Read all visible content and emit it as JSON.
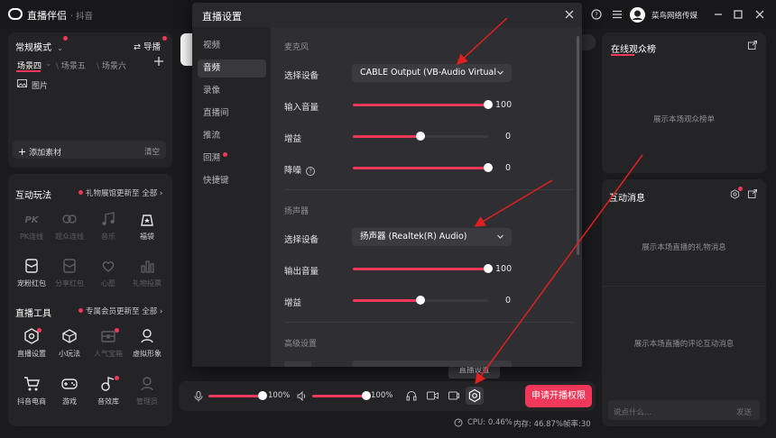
{
  "app": {
    "title": "直播伴侣",
    "subtitle": "· 抖音",
    "user": "菜鸟网络传媒"
  },
  "scene_panel": {
    "mode": "常规模式",
    "guide": "导播",
    "tabs": [
      "场景四",
      "场景五",
      "场景六"
    ],
    "item": "图片",
    "add_source": "添加素材",
    "clear": "清空"
  },
  "interact_panel": {
    "title": "互动玩法",
    "note": "礼物展馆更新至 全部",
    "items": [
      {
        "label": "PK连线",
        "icon": "pk-icon",
        "enabled": false
      },
      {
        "label": "观众连线",
        "icon": "link-icon",
        "enabled": false
      },
      {
        "label": "音乐",
        "icon": "music-icon",
        "enabled": false
      },
      {
        "label": "福袋",
        "icon": "lucky-bag-icon",
        "enabled": true
      },
      {
        "label": "宠粉红包",
        "icon": "red-packet-icon",
        "enabled": true
      },
      {
        "label": "分享红包",
        "icon": "share-packet-icon",
        "enabled": false
      },
      {
        "label": "心愿",
        "icon": "wish-icon",
        "enabled": false
      },
      {
        "label": "礼物投票",
        "icon": "vote-icon",
        "enabled": false
      }
    ]
  },
  "tools_panel": {
    "title": "直播工具",
    "note": "专属会员更新至 全部",
    "items": [
      {
        "label": "直播设置",
        "icon": "live-settings-icon",
        "enabled": true
      },
      {
        "label": "小玩法",
        "icon": "mini-game-icon",
        "enabled": true
      },
      {
        "label": "人气宝箱",
        "icon": "treasure-box-icon",
        "enabled": false
      },
      {
        "label": "虚拟形象",
        "icon": "avatar-icon",
        "enabled": true
      },
      {
        "label": "抖音电商",
        "icon": "shop-cart-icon",
        "enabled": true
      },
      {
        "label": "游戏",
        "icon": "gamepad-icon",
        "enabled": true
      },
      {
        "label": "音效库",
        "icon": "sound-library-icon",
        "enabled": true
      },
      {
        "label": "管理员",
        "icon": "admin-icon",
        "enabled": false
      }
    ]
  },
  "bottom_bar": {
    "mic_volume": "100%",
    "mic_level": 1.0,
    "speaker_volume": "100%",
    "speaker_level": 1.0,
    "tooltip": "直播设置",
    "apply_button": "申请开播权限"
  },
  "status_bar": {
    "cpu": "CPU: 0.46%",
    "memory": "内存: 46.87%",
    "fps": "帧率:30"
  },
  "right_panels": {
    "audience_title": "在线观众榜",
    "audience_empty": "展示本场观众榜单",
    "messages_title": "互动消息",
    "gift_empty": "展示本场直播的礼物消息",
    "comment_empty": "展示本场直播的评论互动消息",
    "input_placeholder": "说点什么...",
    "send": "发送"
  },
  "dialog": {
    "title": "直播设置",
    "nav": [
      "视频",
      "音频",
      "录像",
      "直播间",
      "推流",
      "回溯",
      "快捷键"
    ],
    "active_nav": "音频",
    "mic": {
      "group": "麦克风",
      "device_label": "选择设备",
      "device_value": "CABLE Output (VB-Audio Virtual",
      "input_label": "输入音量",
      "input_value": "100",
      "input_level": 1.0,
      "gain_label": "增益",
      "gain_value": "0",
      "gain_level": 0.5,
      "noise_label": "降噪",
      "noise_value": "0",
      "noise_level": 1.0
    },
    "speaker": {
      "group": "扬声器",
      "device_label": "选择设备",
      "device_value": "扬声器 (Realtek(R) Audio)",
      "output_label": "输出音量",
      "output_value": "100",
      "output_level": 1.0,
      "gain_label": "增益",
      "gain_value": "0",
      "gain_level": 0.5
    },
    "advanced_group": "高级设置"
  },
  "colors": {
    "accent": "#f0385a",
    "background": "#1b1b1e",
    "panel": "#242427",
    "annotation_arrow": "#e02020"
  }
}
